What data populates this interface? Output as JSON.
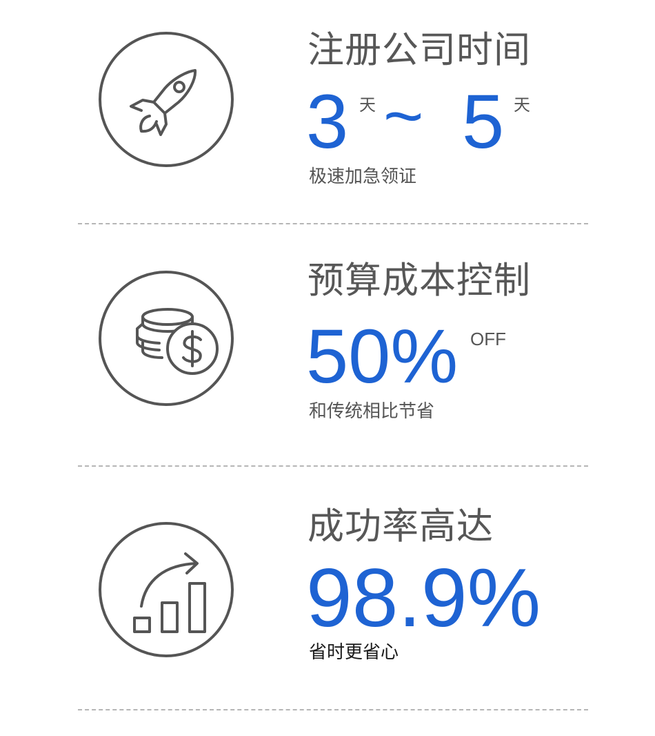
{
  "features": [
    {
      "icon": "rocket-icon",
      "title": "注册公司时间",
      "value_a": "3",
      "unit_a": "天",
      "tilde": "~",
      "value_b": "5",
      "unit_b": "天",
      "subtitle": "极速加急领证"
    },
    {
      "icon": "coins-dollar-icon",
      "title": "预算成本控制",
      "value": "50%",
      "suffix": "OFF",
      "subtitle": "和传统相比节省"
    },
    {
      "icon": "growth-chart-icon",
      "title": "成功率高达",
      "value": "98.9%",
      "subtitle": "省时更省心"
    }
  ],
  "colors": {
    "accent": "#1e63d3",
    "text": "#555555",
    "divider": "#b5b5b5"
  }
}
